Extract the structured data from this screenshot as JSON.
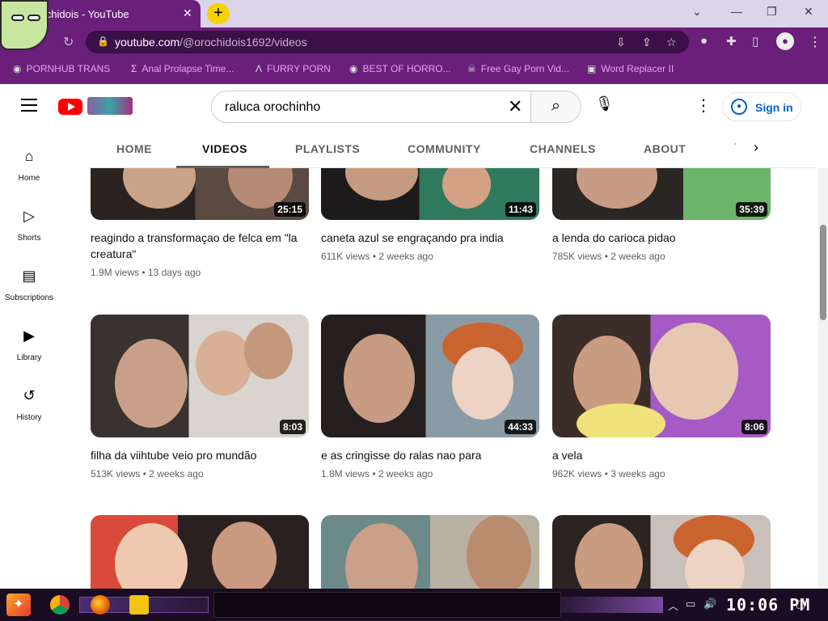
{
  "browser": {
    "tab_title": "orochidois - YouTube",
    "url_host": "youtube.com",
    "url_path": "/@orochidois1692/videos",
    "bookmarks": [
      {
        "label": "PORNHUB TRANS",
        "icon": "globe-icon"
      },
      {
        "label": "Anal Prolapse Time...",
        "icon": "sigma-icon"
      },
      {
        "label": "FURRY PORN",
        "icon": "lambda-icon"
      },
      {
        "label": "BEST OF HORRO...",
        "icon": "globe-icon"
      },
      {
        "label": "Free Gay Porn Vid...",
        "icon": "skull-icon"
      },
      {
        "label": "Word Replacer II",
        "icon": "wr-icon"
      }
    ]
  },
  "youtube": {
    "search_query": "raluca orochinho",
    "sign_in_label": "Sign in",
    "channel_tabs": [
      "HOME",
      "VIDEOS",
      "PLAYLISTS",
      "COMMUNITY",
      "CHANNELS",
      "ABOUT"
    ],
    "active_tab": "VIDEOS",
    "sidebar": [
      {
        "label": "Home",
        "icon": "home-icon"
      },
      {
        "label": "Shorts",
        "icon": "shorts-icon"
      },
      {
        "label": "Subscriptions",
        "icon": "subscriptions-icon"
      },
      {
        "label": "Library",
        "icon": "library-icon"
      },
      {
        "label": "History",
        "icon": "history-icon"
      }
    ],
    "videos": [
      {
        "title": "reagindo a transformaçao de felca em \"la creatura\"",
        "views": "1.9M views",
        "age": "13 days ago",
        "duration": "25:15"
      },
      {
        "title": "caneta azul se engraçando pra india",
        "views": "611K views",
        "age": "2 weeks ago",
        "duration": "11:43"
      },
      {
        "title": "a lenda do carioca pidao",
        "views": "785K views",
        "age": "2 weeks ago",
        "duration": "35:39"
      },
      {
        "title": "filha da viihtube veio pro mundão",
        "views": "513K views",
        "age": "2 weeks ago",
        "duration": "8:03"
      },
      {
        "title": "e as cringisse do ralas nao para",
        "views": "1.8M views",
        "age": "2 weeks ago",
        "duration": "44:33"
      },
      {
        "title": "a vela",
        "views": "962K views",
        "age": "3 weeks ago",
        "duration": "8:06"
      }
    ]
  },
  "taskbar": {
    "clock": "10:06 PM"
  },
  "colors": {
    "chrome_theme": "#6a1f7a",
    "bookmark_text": "#e8a3f4",
    "yt_red": "#ff0000",
    "link_blue": "#065fd4"
  }
}
